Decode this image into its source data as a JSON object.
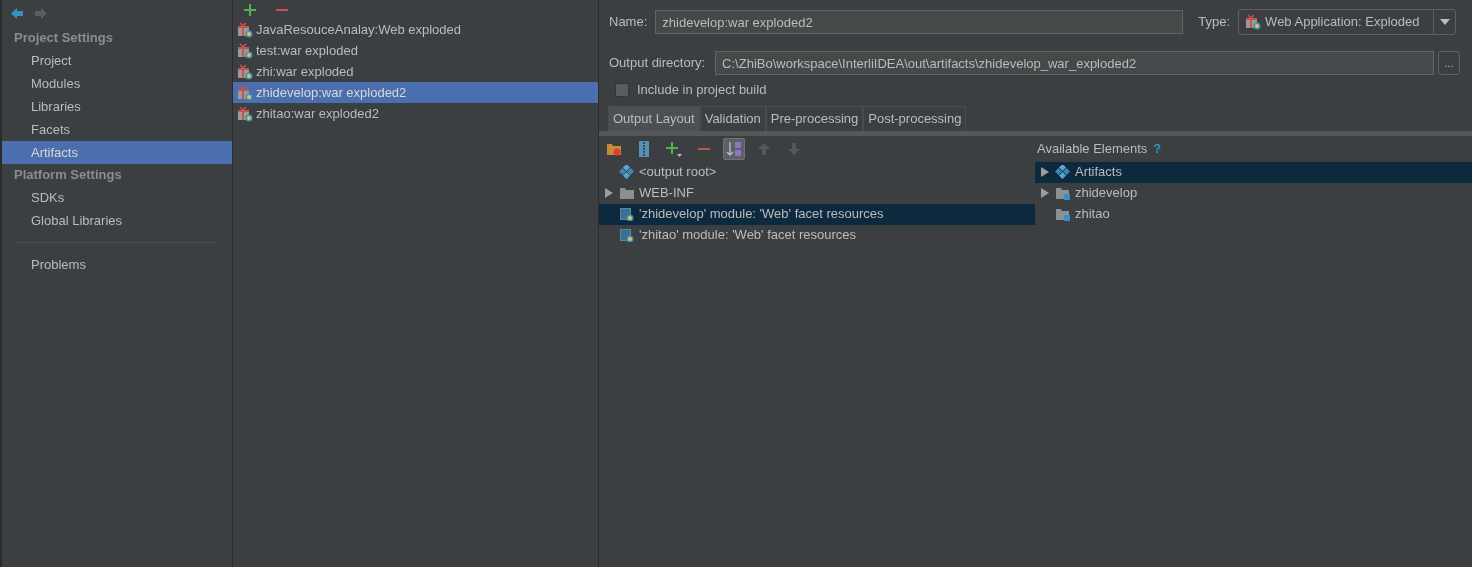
{
  "sidebar": {
    "sections": [
      {
        "heading": "Project Settings",
        "items": [
          {
            "label": "Project",
            "selected": false
          },
          {
            "label": "Modules",
            "selected": false
          },
          {
            "label": "Libraries",
            "selected": false
          },
          {
            "label": "Facets",
            "selected": false
          },
          {
            "label": "Artifacts",
            "selected": true
          }
        ]
      },
      {
        "heading": "Platform Settings",
        "items": [
          {
            "label": "SDKs",
            "selected": false
          },
          {
            "label": "Global Libraries",
            "selected": false
          }
        ]
      }
    ],
    "problems": {
      "label": "Problems",
      "selected": false
    }
  },
  "artifacts": [
    {
      "label": "JavaResouceAnalay:Web exploded",
      "selected": false
    },
    {
      "label": "test:war exploded",
      "selected": false
    },
    {
      "label": "zhi:war exploded",
      "selected": false
    },
    {
      "label": "zhidevelop:war exploded2",
      "selected": true
    },
    {
      "label": "zhitao:war exploded2",
      "selected": false
    }
  ],
  "editor": {
    "name_label": "Name:",
    "name_value": "zhidevelop:war exploded2",
    "type_label": "Type:",
    "type_value": "Web Application: Exploded",
    "output_label": "Output directory:",
    "output_value": "C:\\ZhiBo\\workspace\\InterliIDEA\\out\\artifacts\\zhidevelop_war_exploded2",
    "browse": "...",
    "include_build": {
      "label": "Include in project build",
      "checked": false
    },
    "tabs": [
      {
        "label": "Output Layout",
        "selected": true
      },
      {
        "label": "Validation",
        "selected": false
      },
      {
        "label": "Pre-processing",
        "selected": false
      },
      {
        "label": "Post-processing",
        "selected": false
      }
    ],
    "sort_pressed": true,
    "layout_tree": [
      {
        "label": "<output root>",
        "kind": "root",
        "collapsed": false,
        "selected": false
      },
      {
        "label": "WEB-INF",
        "kind": "folder",
        "collapsed": true,
        "selected": false
      },
      {
        "label": "'zhidevelop' module: 'Web' facet resources",
        "kind": "web",
        "collapsed": false,
        "selected": true
      },
      {
        "label": "'zhitao' module: 'Web' facet resources",
        "kind": "web",
        "collapsed": false,
        "selected": false
      }
    ],
    "available_title": "Available Elements",
    "help": "?",
    "available_tree": [
      {
        "label": "Artifacts",
        "kind": "root",
        "collapsed": true,
        "selected": true
      },
      {
        "label": "zhidevelop",
        "kind": "module",
        "collapsed": true,
        "selected": false
      },
      {
        "label": "zhitao",
        "kind": "module",
        "collapsed": false,
        "selected": false
      }
    ]
  }
}
